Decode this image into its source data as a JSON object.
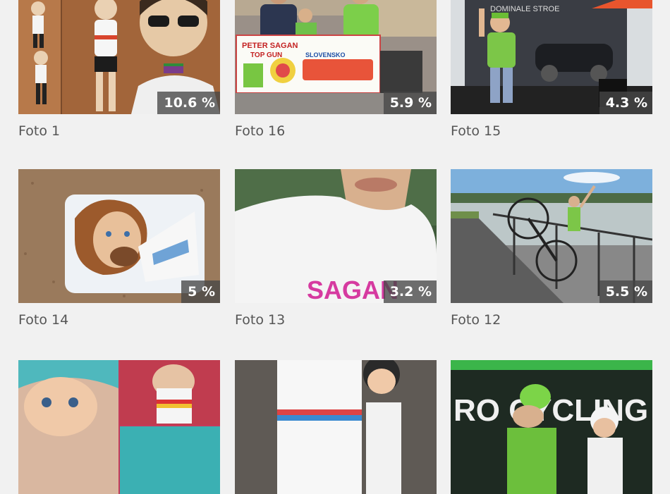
{
  "gallery": {
    "items": [
      {
        "caption": "Foto 1",
        "percent": "10.6 %"
      },
      {
        "caption": "Foto 16",
        "percent": "5.9 %"
      },
      {
        "caption": "Foto 15",
        "percent": "4.3 %"
      },
      {
        "caption": "Foto 14",
        "percent": "5 %"
      },
      {
        "caption": "Foto 13",
        "percent": "3.2 %"
      },
      {
        "caption": "Foto 12",
        "percent": "5.5 %"
      },
      {
        "caption": "",
        "percent": ""
      },
      {
        "caption": "",
        "percent": ""
      },
      {
        "caption": "",
        "percent": ""
      }
    ],
    "photo_text": {
      "banner_line1": "PETER SAGAN",
      "banner_line2": "TOP GUN",
      "banner_slovak": "SLOVENSKO",
      "stage_sign": "DOMINALE STROE",
      "shirt_text": "SAGAN",
      "team_text": "RO CYCLING"
    }
  }
}
